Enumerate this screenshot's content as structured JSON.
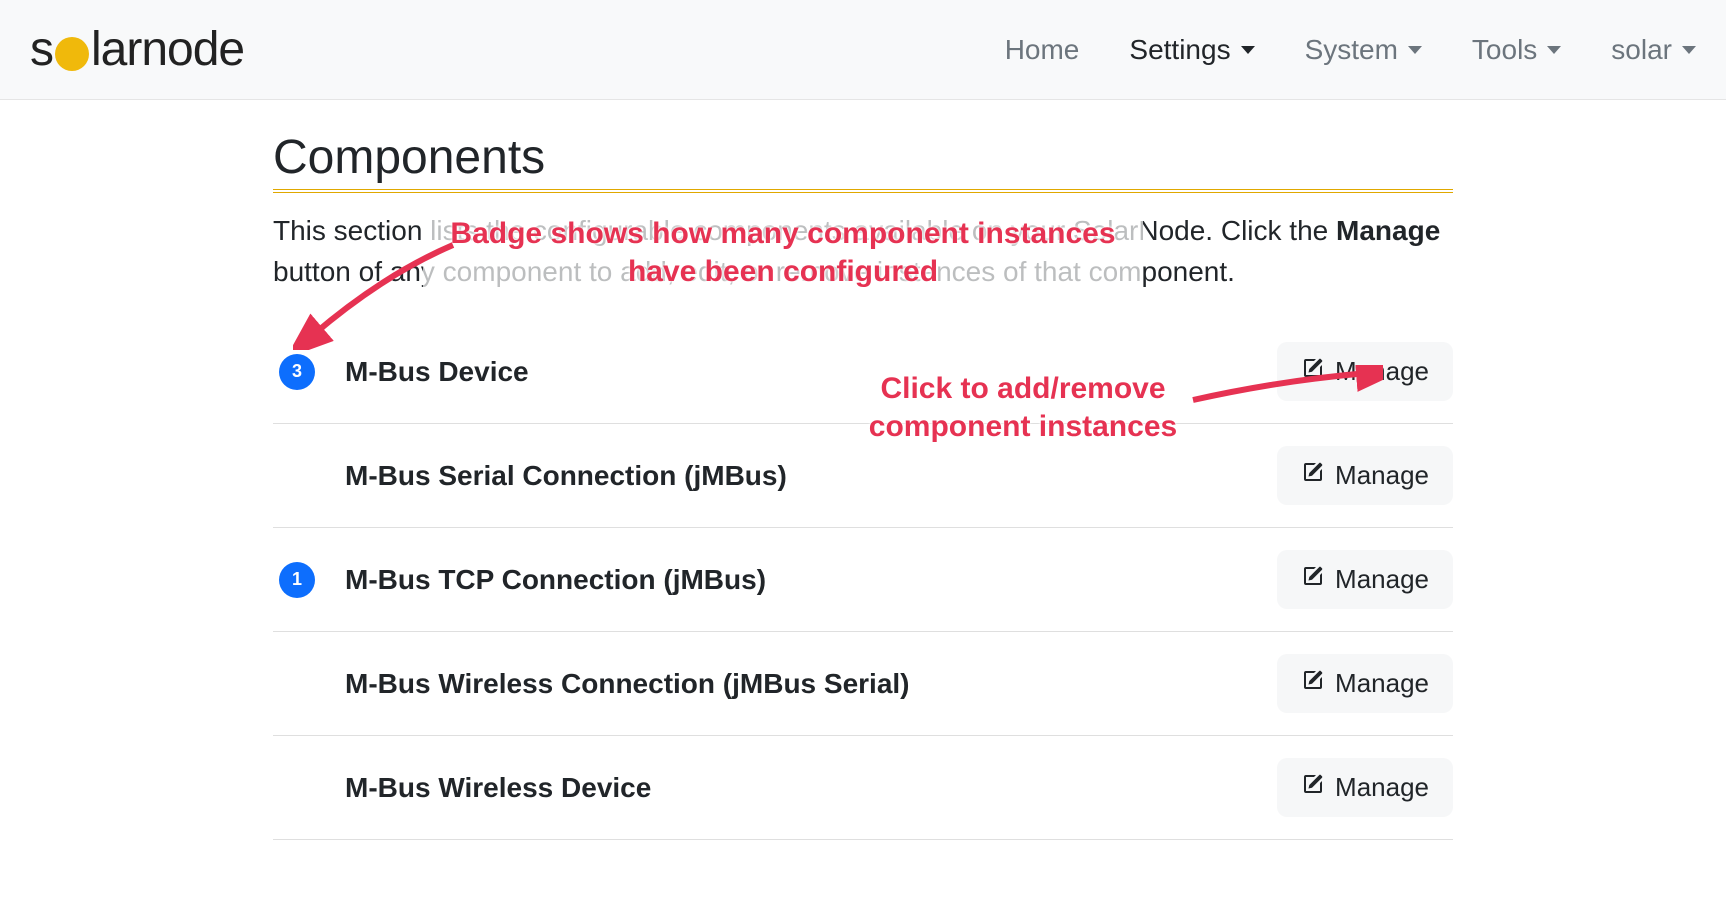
{
  "brand": {
    "pre": "s",
    "post": "larnode"
  },
  "nav": {
    "home": "Home",
    "settings": "Settings",
    "system": "System",
    "tools": "Tools",
    "user": "solar"
  },
  "page": {
    "title": "Components",
    "intro_pre": "This section lists the configurable components available on your SolarNode. Click the ",
    "intro_strong": "Manage",
    "intro_post": " button of any component to add, edit, or remove instances of that component."
  },
  "annotations": {
    "badge": "Badge shows how many component instances have been configured",
    "manage": "Click to add/remove component instances"
  },
  "manage_label": "Manage",
  "components": [
    {
      "count": "3",
      "name": "M-Bus Device"
    },
    {
      "count": "",
      "name": "M-Bus Serial Connection (jMBus)"
    },
    {
      "count": "1",
      "name": "M-Bus TCP Connection (jMBus)"
    },
    {
      "count": "",
      "name": "M-Bus Wireless Connection (jMBus Serial)"
    },
    {
      "count": "",
      "name": "M-Bus Wireless Device"
    }
  ]
}
